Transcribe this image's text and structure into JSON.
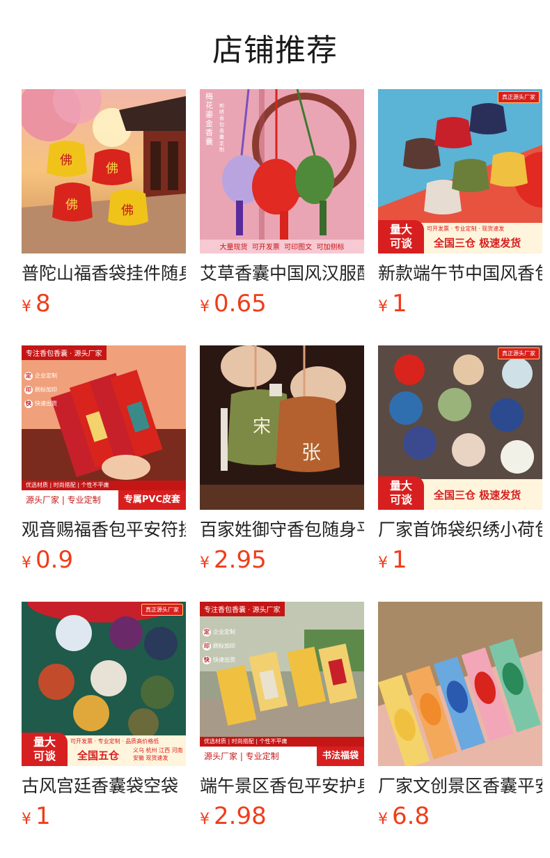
{
  "page_title": "店铺推荐",
  "currency": "¥",
  "products": [
    {
      "name": "普陀山福香袋挂件随身",
      "price": "8",
      "image": {
        "bags": [
          "佛",
          "佛",
          "佛",
          "佛"
        ]
      }
    },
    {
      "name": "艾草香囊中国风汉服配",
      "price": "0.65",
      "image": {
        "vertical_text": "梅花鎏金香囊",
        "vertical_sub": "刺绣香包·香囊定制",
        "footer": [
          "大量现货",
          "可开发票",
          "可印图文",
          "可加侧标"
        ]
      }
    },
    {
      "name": "新款端午节中国风香包",
      "price": "1",
      "image": {
        "tag": "真正源头厂家",
        "badge": [
          "量大",
          "可谈"
        ],
        "band_top": "可开发票 · 专业定制 · 现货速发",
        "band_bottom": "全国三仓  极速发货"
      }
    },
    {
      "name": "观音赐福香包平安符挂",
      "price": "0.9",
      "image": {
        "header": "专注香包香囊 · 源头厂家",
        "side": [
          [
            "定",
            "企业定制"
          ],
          [
            "印",
            "刷标加印"
          ],
          [
            "快",
            "快速出货"
          ]
        ],
        "strip": "优选材质 | 时尚搭配 | 个性不平庸",
        "foot_left": "源头厂家 | 专业定制",
        "foot_right": "专属PVC皮套"
      }
    },
    {
      "name": "百家姓御守香包随身平",
      "price": "2.95",
      "image": {
        "chars": [
          "宋",
          "张"
        ]
      }
    },
    {
      "name": "厂家首饰袋织绣小荷包",
      "price": "1",
      "image": {
        "tag": "真正源头厂家",
        "badge": [
          "量大",
          "可谈"
        ],
        "band_bottom": "全国三仓  极速发货"
      }
    },
    {
      "name": "古风宫廷香囊袋空袋",
      "price": "1",
      "image": {
        "tag": "真正源头厂家",
        "badge": [
          "量大",
          "可谈"
        ],
        "band_top": "可开发票 · 专业定制 · 品质高价格低",
        "band_bottom": "全国五仓",
        "cities": "义乌 杭州 江西 河南 安徽 现货速发"
      }
    },
    {
      "name": "端午景区香包平安护身",
      "price": "2.98",
      "image": {
        "header": "专注香包香囊 · 源头厂家",
        "side": [
          [
            "定",
            "企业定制"
          ],
          [
            "印",
            "刷标加印"
          ],
          [
            "快",
            "快速出货"
          ]
        ],
        "strip": "优选材质 | 时尚搭配 | 个性不平庸",
        "foot_left": "源头厂家 | 专业定制",
        "foot_right": "书法福袋"
      }
    },
    {
      "name": "厂家文创景区香囊平安",
      "price": "6.8",
      "image": {}
    }
  ]
}
